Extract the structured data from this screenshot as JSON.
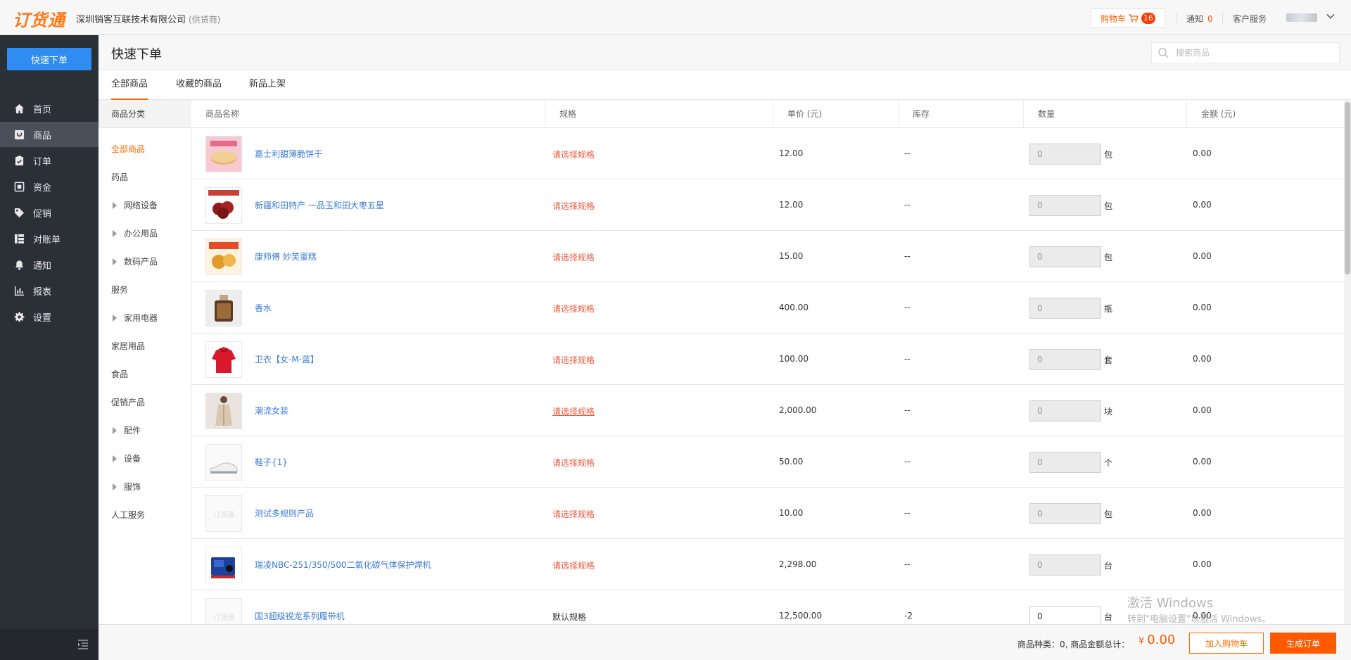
{
  "header": {
    "logo": "订货通",
    "company": "深圳销客互联技术有限公司",
    "company_role": "(供货商)",
    "cart_label": "购物车",
    "cart_count": "16",
    "notice_label": "通知",
    "notice_count": "0",
    "service_label": "客户服务"
  },
  "sidebar": {
    "quick_order": "快速下单",
    "items": [
      {
        "label": "首页",
        "icon": "home-icon"
      },
      {
        "label": "商品",
        "icon": "goods-icon"
      },
      {
        "label": "订单",
        "icon": "order-icon"
      },
      {
        "label": "资金",
        "icon": "funds-icon"
      },
      {
        "label": "促销",
        "icon": "tag-icon"
      },
      {
        "label": "对账单",
        "icon": "statement-icon"
      },
      {
        "label": "通知",
        "icon": "bell-icon"
      },
      {
        "label": "报表",
        "icon": "chart-icon"
      },
      {
        "label": "设置",
        "icon": "gear-icon"
      }
    ]
  },
  "page": {
    "title": "快速下单",
    "search_placeholder": "搜索商品"
  },
  "tabs": [
    "全部商品",
    "收藏的商品",
    "新品上架"
  ],
  "categories": {
    "header": "商品分类",
    "items": [
      {
        "label": "全部商品",
        "expandable": false
      },
      {
        "label": "药品",
        "expandable": false
      },
      {
        "label": "网络设备",
        "expandable": true
      },
      {
        "label": "办公用品",
        "expandable": true
      },
      {
        "label": "数码产品",
        "expandable": true
      },
      {
        "label": "服务",
        "expandable": false
      },
      {
        "label": "家用电器",
        "expandable": true
      },
      {
        "label": "家居用品",
        "expandable": false
      },
      {
        "label": "食品",
        "expandable": false
      },
      {
        "label": "促销产品",
        "expandable": false
      },
      {
        "label": "配件",
        "expandable": true
      },
      {
        "label": "设备",
        "expandable": true
      },
      {
        "label": "服饰",
        "expandable": true
      },
      {
        "label": "人工服务",
        "expandable": false
      }
    ]
  },
  "table": {
    "columns": [
      "商品名称",
      "规格",
      "单价 (元)",
      "库存",
      "数量",
      "金额 (元)"
    ],
    "rows": [
      {
        "name": "嘉士利甜薄脆饼干",
        "spec": "请选择规格",
        "price": "12.00",
        "stock": "--",
        "qty": "0",
        "unit": "包",
        "amount": "0.00"
      },
      {
        "name": "新疆和田特产 一品玉和田大枣五星",
        "spec": "请选择规格",
        "price": "12.00",
        "stock": "--",
        "qty": "0",
        "unit": "包",
        "amount": "0.00"
      },
      {
        "name": "康师傅 妙芙蛋糕",
        "spec": "请选择规格",
        "price": "15.00",
        "stock": "--",
        "qty": "0",
        "unit": "包",
        "amount": "0.00"
      },
      {
        "name": "香水",
        "spec": "请选择规格",
        "price": "400.00",
        "stock": "--",
        "qty": "0",
        "unit": "瓶",
        "amount": "0.00"
      },
      {
        "name": "卫衣【女-M-蓝】",
        "spec": "请选择规格",
        "price": "100.00",
        "stock": "--",
        "qty": "0",
        "unit": "套",
        "amount": "0.00"
      },
      {
        "name": "潮流女装",
        "spec": "请选择规格",
        "price": "2,000.00",
        "stock": "--",
        "qty": "0",
        "unit": "块",
        "amount": "0.00"
      },
      {
        "name": "鞋子{1}",
        "spec": "请选择规格",
        "price": "50.00",
        "stock": "--",
        "qty": "0",
        "unit": "个",
        "amount": "0.00"
      },
      {
        "name": "测试多规则产品",
        "spec": "请选择规格",
        "price": "10.00",
        "stock": "--",
        "qty": "0",
        "unit": "包",
        "amount": "0.00"
      },
      {
        "name": "瑞凌NBC-251/350/500二氧化碳气体保护焊机",
        "spec": "请选择规格",
        "price": "2,298.00",
        "stock": "--",
        "qty": "0",
        "unit": "台",
        "amount": "0.00"
      },
      {
        "name": "国3超级锐龙系列履带机",
        "spec": "默认规格",
        "price": "12,500.00",
        "stock": "-2",
        "qty": "0",
        "unit": "台",
        "amount": "0.00"
      }
    ],
    "placeholder_logo": "订货通"
  },
  "watermark": {
    "line1": "激活 Windows",
    "line2": "转到\"电脑设置\"以激活 Windows。"
  },
  "footer": {
    "summary": "商品种类：0,    商品金额总计：",
    "currency": "¥",
    "total": "0.00",
    "add_cart": "加入购物车",
    "create_order": "生成订单"
  },
  "colors": {
    "brand": "#ff6a00",
    "primary_button": "#2f8cf0",
    "sidebar": "#2b2f36",
    "link": "#3a7bd5",
    "spec_warning": "#f05a3c"
  }
}
